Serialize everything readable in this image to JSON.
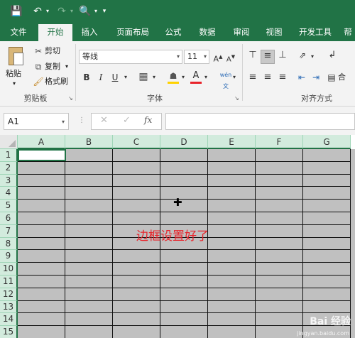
{
  "ribbon_tabs": [
    {
      "label": "文件"
    },
    {
      "label": "开始"
    },
    {
      "label": "插入"
    },
    {
      "label": "页面布局"
    },
    {
      "label": "公式"
    },
    {
      "label": "数据"
    },
    {
      "label": "审阅"
    },
    {
      "label": "视图"
    },
    {
      "label": "开发工具"
    },
    {
      "label": "帮"
    }
  ],
  "active_tab": "开始",
  "clipboard": {
    "paste_label": "粘贴",
    "cut_label": "剪切",
    "copy_label": "复制",
    "format_painter_label": "格式刷",
    "group_label": "剪贴板"
  },
  "font": {
    "font_name": "等线",
    "font_size": "11",
    "group_label": "字体",
    "bold": "B",
    "italic": "I",
    "underline": "U"
  },
  "alignment": {
    "group_label": "对齐方式",
    "merge_label": "合"
  },
  "formula_bar": {
    "name_box": "A1",
    "fx_label": "fx",
    "formula": ""
  },
  "sheet": {
    "columns": [
      "A",
      "B",
      "C",
      "D",
      "E",
      "F",
      "G"
    ],
    "rows": [
      "1",
      "2",
      "3",
      "4",
      "5",
      "6",
      "7",
      "8",
      "9",
      "10",
      "11",
      "12",
      "13",
      "14",
      "15"
    ],
    "active_cell": "A1",
    "annotation": "边框设置好了"
  },
  "watermark": {
    "text": "Bai 经验",
    "url": "jingyan.baidu.com"
  },
  "colors": {
    "excel_green": "#217346",
    "cell_fill": "#c0c0c0",
    "annotation_red": "#e8232a"
  }
}
